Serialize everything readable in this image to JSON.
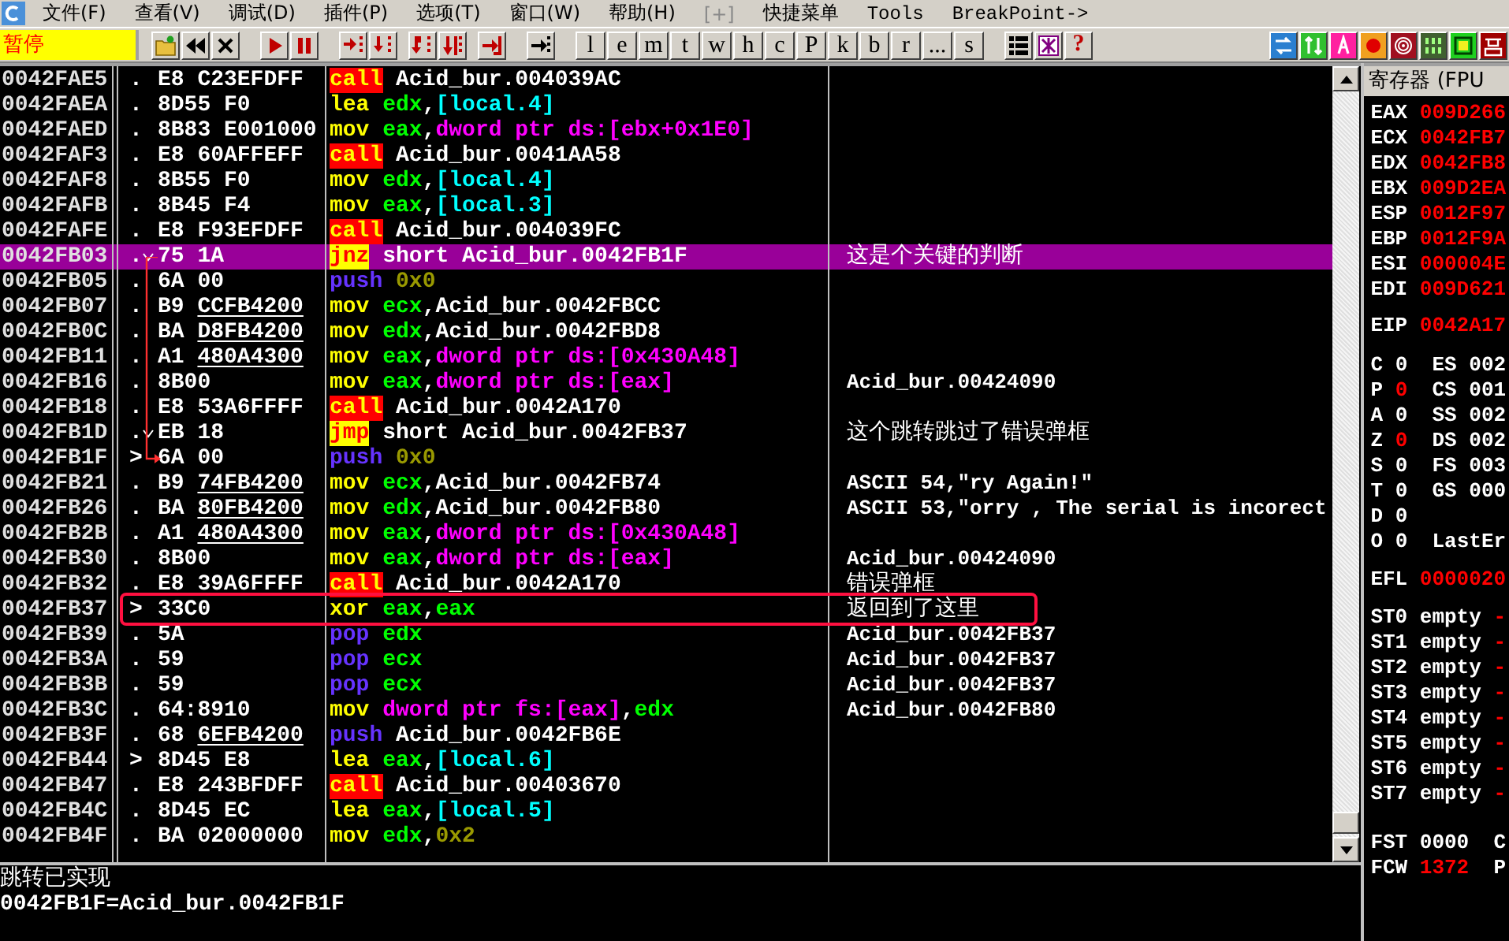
{
  "menu": [
    {
      "label": "文件(F)",
      "disabled": false
    },
    {
      "label": "查看(V)",
      "disabled": false
    },
    {
      "label": "调试(D)",
      "disabled": false
    },
    {
      "label": "插件(P)",
      "disabled": false
    },
    {
      "label": "选项(T)",
      "disabled": false
    },
    {
      "label": "窗口(W)",
      "disabled": false
    },
    {
      "label": "帮助(H)",
      "disabled": false
    },
    {
      "label": "[+]",
      "disabled": true
    },
    {
      "label": "快捷菜单",
      "disabled": false
    },
    {
      "label": "Tools",
      "disabled": false
    },
    {
      "label": "BreakPoint->",
      "disabled": false
    }
  ],
  "toolbar": {
    "status": "暂停",
    "letters": [
      "l",
      "e",
      "m",
      "t",
      "w",
      "h",
      "c",
      "P",
      "k",
      "b",
      "r",
      "...",
      "s"
    ],
    "help": "?"
  },
  "rows": [
    {
      "address": "0042FAE5",
      "mark": ".",
      "branch": false,
      "hex": "E8 C23EFDFF",
      "mnemonic": "call",
      "kind": "call",
      "operands": [
        {
          "text": "Acid_bur.004039AC",
          "kind": "sym"
        }
      ],
      "selected": false,
      "boxed": false
    },
    {
      "address": "0042FAEA",
      "mark": ".",
      "branch": false,
      "hex": "8D55 F0",
      "mnemonic": "lea",
      "kind": "op",
      "operands": [
        {
          "text": "edx",
          "kind": "reg"
        },
        {
          "text": ",",
          "kind": "sym"
        },
        {
          "text": "[local.4]",
          "kind": "local"
        }
      ],
      "selected": false,
      "boxed": false
    },
    {
      "address": "0042FAED",
      "mark": ".",
      "branch": false,
      "hex": "8B83 E001000",
      "mnemonic": "mov",
      "kind": "op",
      "operands": [
        {
          "text": "eax",
          "kind": "reg"
        },
        {
          "text": ",",
          "kind": "sym"
        },
        {
          "text": "dword ptr ds:[ebx+0x1E0]",
          "kind": "mem"
        }
      ],
      "selected": false,
      "boxed": false
    },
    {
      "address": "0042FAF3",
      "mark": ".",
      "branch": false,
      "hex": "E8 60AFFEFF",
      "mnemonic": "call",
      "kind": "call",
      "operands": [
        {
          "text": "Acid_bur.0041AA58",
          "kind": "sym"
        }
      ],
      "selected": false,
      "boxed": false
    },
    {
      "address": "0042FAF8",
      "mark": ".",
      "branch": false,
      "hex": "8B55 F0",
      "mnemonic": "mov",
      "kind": "op",
      "operands": [
        {
          "text": "edx",
          "kind": "reg"
        },
        {
          "text": ",",
          "kind": "sym"
        },
        {
          "text": "[local.4]",
          "kind": "local"
        }
      ],
      "selected": false,
      "boxed": false
    },
    {
      "address": "0042FAFB",
      "mark": ".",
      "branch": false,
      "hex": "8B45 F4",
      "mnemonic": "mov",
      "kind": "op",
      "operands": [
        {
          "text": "eax",
          "kind": "reg"
        },
        {
          "text": ",",
          "kind": "sym"
        },
        {
          "text": "[local.3]",
          "kind": "local"
        }
      ],
      "selected": false,
      "boxed": false
    },
    {
      "address": "0042FAFE",
      "mark": ".",
      "branch": false,
      "hex": "E8 F93EFDFF",
      "mnemonic": "call",
      "kind": "call",
      "operands": [
        {
          "text": "Acid_bur.004039FC",
          "kind": "sym"
        }
      ],
      "selected": false,
      "boxed": false
    },
    {
      "address": "0042FB03",
      "mark": ".",
      "branch": true,
      "arrow_from": true,
      "hex": "75 1A",
      "mnemonic": "jnz",
      "kind": "jump",
      "operands": [
        {
          "text": "short Acid_bur.0042FB1F",
          "kind": "sym"
        }
      ],
      "comment": "这是个关键的判断",
      "selected": true,
      "boxed": false
    },
    {
      "address": "0042FB05",
      "mark": ".",
      "branch": false,
      "hex": "6A 00",
      "mnemonic": "push",
      "kind": "stack",
      "operands": [
        {
          "text": "0x0",
          "kind": "imm"
        }
      ],
      "selected": false,
      "boxed": false
    },
    {
      "address": "0042FB07",
      "mark": ".",
      "branch": false,
      "hex": "B9",
      "hex_ref": "CCFB4200",
      "mnemonic": "mov",
      "kind": "op",
      "operands": [
        {
          "text": "ecx",
          "kind": "reg"
        },
        {
          "text": ",Acid_bur.0042FBCC",
          "kind": "sym"
        }
      ],
      "selected": false,
      "boxed": false
    },
    {
      "address": "0042FB0C",
      "mark": ".",
      "branch": false,
      "hex": "BA",
      "hex_ref": "D8FB4200",
      "mnemonic": "mov",
      "kind": "op",
      "operands": [
        {
          "text": "edx",
          "kind": "reg"
        },
        {
          "text": ",Acid_bur.0042FBD8",
          "kind": "sym"
        }
      ],
      "selected": false,
      "boxed": false
    },
    {
      "address": "0042FB11",
      "mark": ".",
      "branch": false,
      "hex": "A1",
      "hex_ref": "480A4300",
      "mnemonic": "mov",
      "kind": "op",
      "operands": [
        {
          "text": "eax",
          "kind": "reg"
        },
        {
          "text": ",",
          "kind": "sym"
        },
        {
          "text": "dword ptr ds:[0x430A48]",
          "kind": "mem"
        }
      ],
      "selected": false,
      "boxed": false
    },
    {
      "address": "0042FB16",
      "mark": ".",
      "branch": false,
      "hex": "8B00",
      "mnemonic": "mov",
      "kind": "op",
      "operands": [
        {
          "text": "eax",
          "kind": "reg"
        },
        {
          "text": ",",
          "kind": "sym"
        },
        {
          "text": "dword ptr ds:[eax]",
          "kind": "mem"
        }
      ],
      "comment": "Acid_bur.00424090",
      "selected": false,
      "boxed": false
    },
    {
      "address": "0042FB18",
      "mark": ".",
      "branch": false,
      "hex": "E8 53A6FFFF",
      "mnemonic": "call",
      "kind": "call",
      "operands": [
        {
          "text": "Acid_bur.0042A170",
          "kind": "sym"
        }
      ],
      "selected": false,
      "boxed": false
    },
    {
      "address": "0042FB1D",
      "mark": ".",
      "branch": true,
      "hex": "EB 18",
      "mnemonic": "jmp",
      "kind": "jump",
      "operands": [
        {
          "text": "short Acid_bur.0042FB37",
          "kind": "sym"
        }
      ],
      "comment": "这个跳转跳过了错误弹框",
      "selected": false,
      "boxed": false
    },
    {
      "address": "0042FB1F",
      "mark": ">",
      "branch": false,
      "arrow_to": true,
      "hex": "6A 00",
      "mnemonic": "push",
      "kind": "stack",
      "operands": [
        {
          "text": "0x0",
          "kind": "imm"
        }
      ],
      "selected": false,
      "boxed": false
    },
    {
      "address": "0042FB21",
      "mark": ".",
      "branch": false,
      "hex": "B9",
      "hex_ref": "74FB4200",
      "mnemonic": "mov",
      "kind": "op",
      "operands": [
        {
          "text": "ecx",
          "kind": "reg"
        },
        {
          "text": ",Acid_bur.0042FB74",
          "kind": "sym"
        }
      ],
      "comment": "ASCII 54,\"ry Again!\"",
      "selected": false,
      "boxed": false
    },
    {
      "address": "0042FB26",
      "mark": ".",
      "branch": false,
      "hex": "BA",
      "hex_ref": "80FB4200",
      "mnemonic": "mov",
      "kind": "op",
      "operands": [
        {
          "text": "edx",
          "kind": "reg"
        },
        {
          "text": ",Acid_bur.0042FB80",
          "kind": "sym"
        }
      ],
      "comment": "ASCII 53,\"orry , The serial is incorect",
      "selected": false,
      "boxed": false
    },
    {
      "address": "0042FB2B",
      "mark": ".",
      "branch": false,
      "hex": "A1",
      "hex_ref": "480A4300",
      "mnemonic": "mov",
      "kind": "op",
      "operands": [
        {
          "text": "eax",
          "kind": "reg"
        },
        {
          "text": ",",
          "kind": "sym"
        },
        {
          "text": "dword ptr ds:[0x430A48]",
          "kind": "mem"
        }
      ],
      "selected": false,
      "boxed": false
    },
    {
      "address": "0042FB30",
      "mark": ".",
      "branch": false,
      "hex": "8B00",
      "mnemonic": "mov",
      "kind": "op",
      "operands": [
        {
          "text": "eax",
          "kind": "reg"
        },
        {
          "text": ",",
          "kind": "sym"
        },
        {
          "text": "dword ptr ds:[eax]",
          "kind": "mem"
        }
      ],
      "comment": "Acid_bur.00424090",
      "selected": false,
      "boxed": false
    },
    {
      "address": "0042FB32",
      "mark": ".",
      "branch": false,
      "hex": "E8 39A6FFFF",
      "mnemonic": "call",
      "kind": "call",
      "operands": [
        {
          "text": "Acid_bur.0042A170",
          "kind": "sym"
        }
      ],
      "comment": "错误弹框",
      "selected": false,
      "boxed": false
    },
    {
      "address": "0042FB37",
      "mark": ">",
      "branch": false,
      "hex": "33C0",
      "mnemonic": "xor",
      "kind": "op",
      "operands": [
        {
          "text": "eax",
          "kind": "reg"
        },
        {
          "text": ",",
          "kind": "sym"
        },
        {
          "text": "eax",
          "kind": "reg"
        }
      ],
      "comment": "返回到了这里",
      "selected": false,
      "boxed": true
    },
    {
      "address": "0042FB39",
      "mark": ".",
      "branch": false,
      "hex": "5A",
      "mnemonic": "pop",
      "kind": "stack",
      "operands": [
        {
          "text": "edx",
          "kind": "reg"
        }
      ],
      "comment": "Acid_bur.0042FB37",
      "selected": false,
      "boxed": false
    },
    {
      "address": "0042FB3A",
      "mark": ".",
      "branch": false,
      "hex": "59",
      "mnemonic": "pop",
      "kind": "stack",
      "operands": [
        {
          "text": "ecx",
          "kind": "reg"
        }
      ],
      "comment": "Acid_bur.0042FB37",
      "selected": false,
      "boxed": false
    },
    {
      "address": "0042FB3B",
      "mark": ".",
      "branch": false,
      "hex": "59",
      "mnemonic": "pop",
      "kind": "stack",
      "operands": [
        {
          "text": "ecx",
          "kind": "reg"
        }
      ],
      "comment": "Acid_bur.0042FB37",
      "selected": false,
      "boxed": false
    },
    {
      "address": "0042FB3C",
      "mark": ".",
      "branch": false,
      "hex": "64:8910",
      "mnemonic": "mov",
      "kind": "op",
      "operands": [
        {
          "text": "dword ptr fs:[eax]",
          "kind": "mem"
        },
        {
          "text": ",",
          "kind": "sym"
        },
        {
          "text": "edx",
          "kind": "reg"
        }
      ],
      "comment": "Acid_bur.0042FB80",
      "selected": false,
      "boxed": false
    },
    {
      "address": "0042FB3F",
      "mark": ".",
      "branch": false,
      "hex": "68",
      "hex_ref": "6EFB4200",
      "mnemonic": "push",
      "kind": "stack",
      "operands": [
        {
          "text": "Acid_bur.0042FB6E",
          "kind": "sym"
        }
      ],
      "selected": false,
      "boxed": false
    },
    {
      "address": "0042FB44",
      "mark": ">",
      "branch": false,
      "hex": "8D45 E8",
      "mnemonic": "lea",
      "kind": "op",
      "operands": [
        {
          "text": "eax",
          "kind": "reg"
        },
        {
          "text": ",",
          "kind": "sym"
        },
        {
          "text": "[local.6]",
          "kind": "local"
        }
      ],
      "selected": false,
      "boxed": false
    },
    {
      "address": "0042FB47",
      "mark": ".",
      "branch": false,
      "hex": "E8 243BFDFF",
      "mnemonic": "call",
      "kind": "call",
      "operands": [
        {
          "text": "Acid_bur.00403670",
          "kind": "sym"
        }
      ],
      "selected": false,
      "boxed": false
    },
    {
      "address": "0042FB4C",
      "mark": ".",
      "branch": false,
      "hex": "8D45 EC",
      "mnemonic": "lea",
      "kind": "op",
      "operands": [
        {
          "text": "eax",
          "kind": "reg"
        },
        {
          "text": ",",
          "kind": "sym"
        },
        {
          "text": "[local.5]",
          "kind": "local"
        }
      ],
      "selected": false,
      "boxed": false
    },
    {
      "address": "0042FB4F",
      "mark": ".",
      "branch": false,
      "hex": "BA 02000000",
      "mnemonic": "mov",
      "kind": "op",
      "operands": [
        {
          "text": "edx",
          "kind": "reg"
        },
        {
          "text": ",",
          "kind": "sym"
        },
        {
          "text": "0x2",
          "kind": "imm"
        }
      ],
      "selected": false,
      "boxed": false
    }
  ],
  "info": [
    "跳转已实现",
    "0042FB1F=Acid_bur.0042FB1F"
  ],
  "registers": {
    "title": "寄存器 (FPU",
    "general": [
      {
        "name": "EAX",
        "value": "009D266",
        "changed": true
      },
      {
        "name": "ECX",
        "value": "0042FB7",
        "changed": true
      },
      {
        "name": "EDX",
        "value": "0042FB8",
        "changed": true
      },
      {
        "name": "EBX",
        "value": "009D2EA",
        "changed": true
      },
      {
        "name": "ESP",
        "value": "0012F97",
        "changed": true
      },
      {
        "name": "EBP",
        "value": "0012F9A",
        "changed": true
      },
      {
        "name": "ESI",
        "value": "000004E",
        "changed": true
      },
      {
        "name": "EDI",
        "value": "009D621",
        "changed": true
      }
    ],
    "eip": {
      "name": "EIP",
      "value": "0042A17",
      "changed": true
    },
    "flags": [
      {
        "name": "C",
        "value": "0",
        "changed": false,
        "segment": "ES 002"
      },
      {
        "name": "P",
        "value": "0",
        "changed": true,
        "segment": "CS 001"
      },
      {
        "name": "A",
        "value": "0",
        "changed": false,
        "segment": "SS 002"
      },
      {
        "name": "Z",
        "value": "0",
        "changed": true,
        "segment": "DS 002"
      },
      {
        "name": "S",
        "value": "0",
        "changed": false,
        "segment": "FS 003"
      },
      {
        "name": "T",
        "value": "0",
        "changed": false,
        "segment": "GS 000"
      },
      {
        "name": "D",
        "value": "0",
        "changed": false
      },
      {
        "name": "O",
        "value": "0",
        "changed": false,
        "segment": "LastEr"
      }
    ],
    "efl": {
      "name": "EFL",
      "value": "0000020",
      "changed": true
    },
    "fpu": [
      {
        "name": "ST0",
        "state": "empty",
        "tail": "-"
      },
      {
        "name": "ST1",
        "state": "empty",
        "tail": "-"
      },
      {
        "name": "ST2",
        "state": "empty",
        "tail": "-"
      },
      {
        "name": "ST3",
        "state": "empty",
        "tail": "-"
      },
      {
        "name": "ST4",
        "state": "empty",
        "tail": "-"
      },
      {
        "name": "ST5",
        "state": "empty",
        "tail": "-"
      },
      {
        "name": "ST6",
        "state": "empty",
        "tail": "-"
      },
      {
        "name": "ST7",
        "state": "empty",
        "tail": "-"
      }
    ],
    "status": [
      {
        "name": "FST",
        "value": "0000",
        "changed": false,
        "tail": "C"
      },
      {
        "name": "FCW",
        "value": "1372",
        "changed": true,
        "tail": "P"
      }
    ]
  }
}
